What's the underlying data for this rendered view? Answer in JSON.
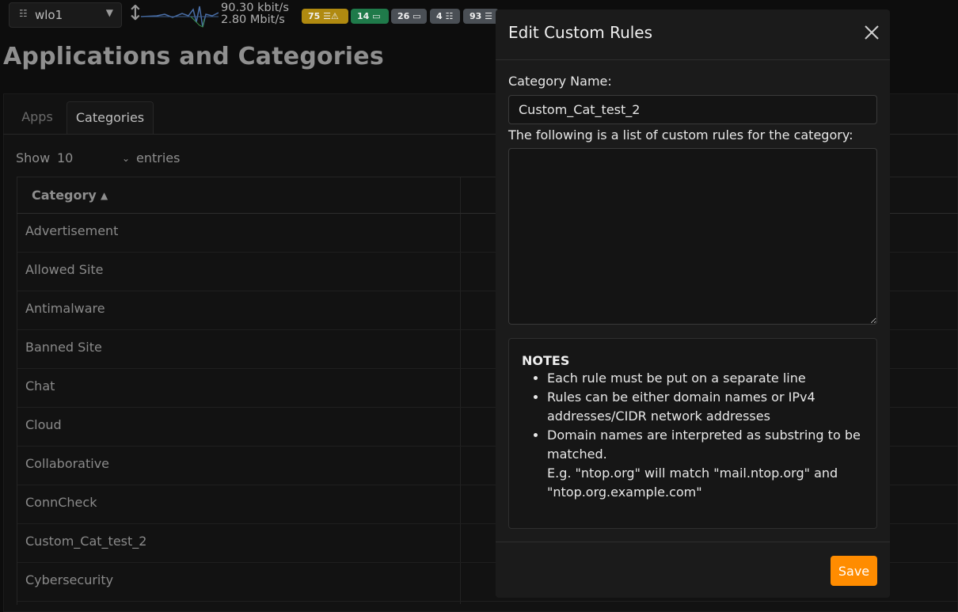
{
  "topbar": {
    "interface": "wlo1",
    "rate_up": "90.30 kbit/s",
    "rate_down": "2.80 Mbit/s",
    "badges": [
      {
        "count": "75",
        "icon": "alert-list-icon",
        "color": "#b08a10"
      },
      {
        "count": "14",
        "icon": "laptop-icon",
        "color": "#1f7a4a"
      },
      {
        "count": "26",
        "icon": "laptop-icon",
        "color": "#4a4f55"
      },
      {
        "count": "4",
        "icon": "router-icon",
        "color": "#4a4f55"
      },
      {
        "count": "93",
        "icon": "list-icon",
        "color": "#4a4f55"
      }
    ]
  },
  "page": {
    "title": "Applications and Categories",
    "tabs": [
      {
        "label": "Apps",
        "active": false
      },
      {
        "label": "Categories",
        "active": true
      }
    ],
    "show_label": "Show",
    "entries_value": "10",
    "entries_label": "entries",
    "table": {
      "header": "Category",
      "rows": [
        "Advertisement",
        "Allowed Site",
        "Antimalware",
        "Banned Site",
        "Chat",
        "Cloud",
        "Collaborative",
        "ConnCheck",
        "Custom_Cat_test_2",
        "Cybersecurity"
      ]
    }
  },
  "modal": {
    "title": "Edit Custom Rules",
    "name_label": "Category Name:",
    "name_value": "Custom_Cat_test_2",
    "rules_label": "The following is a list of custom rules for the category:",
    "rules_value": "",
    "notes_title": "NOTES",
    "notes": {
      "n1": "Each rule must be put on a separate line",
      "n2": "Rules can be either domain names or IPv4 addresses/CIDR network addresses",
      "n3": "Domain names are interpreted as substring to be matched.",
      "n3_example": "E.g. \"ntop.org\" will match \"mail.ntop.org\" and \"ntop.org.example.com\""
    },
    "save_label": "Save",
    "accent": "#ff8c00"
  }
}
